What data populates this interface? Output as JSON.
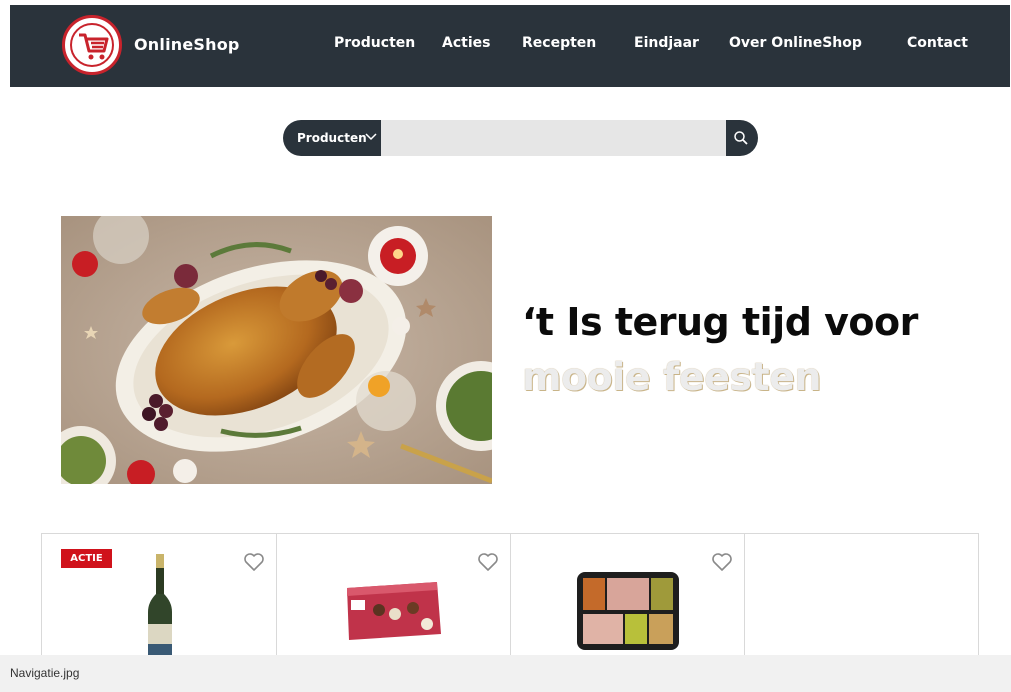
{
  "header": {
    "brand": "OnlineShop",
    "nav": [
      "Producten",
      "Acties",
      "Recepten",
      "Eindjaar",
      "Over OnlineShop",
      "Contact"
    ]
  },
  "search": {
    "category": "Producten",
    "placeholder": "",
    "value": ""
  },
  "hero": {
    "line1": "‘t Is terug tijd voor",
    "line2": "mooie feesten"
  },
  "products": [
    {
      "badge": "ACTIE",
      "item": "champagne-bottle"
    },
    {
      "badge": "",
      "item": "pralines-box"
    },
    {
      "badge": "",
      "item": "tapas-tray"
    },
    {
      "badge": "",
      "item": ""
    }
  ],
  "filebar": {
    "filename": "Navigatie.jpg"
  },
  "colors": {
    "header_bg": "#2a333b",
    "brand_red": "#c8232c",
    "badge_red": "#d0121b",
    "search_bg": "#e6e6e6"
  }
}
